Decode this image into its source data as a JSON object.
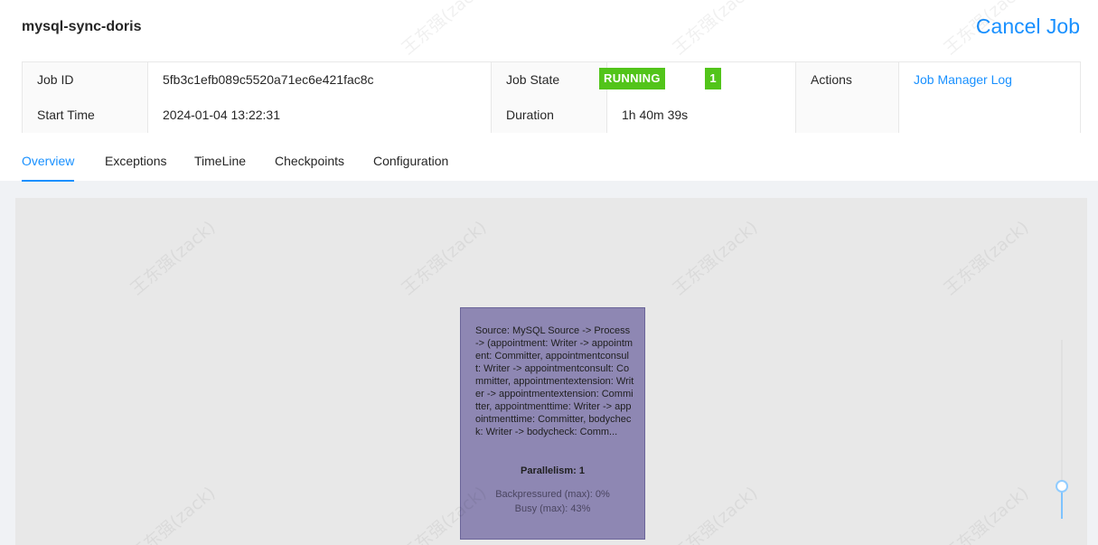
{
  "job": {
    "name": "mysql-sync-doris",
    "cancel_label": "Cancel Job"
  },
  "details": {
    "job_id_label": "Job ID",
    "job_id": "5fb3c1efb089c5520a71ec6e421fac8c",
    "job_state_label": "Job State",
    "job_state": "RUNNING",
    "running_count": "1",
    "actions_label": "Actions",
    "job_manager_log": "Job Manager Log",
    "start_time_label": "Start Time",
    "start_time": "2024-01-04 13:22:31",
    "duration_label": "Duration",
    "duration": "1h 40m 39s"
  },
  "tabs": [
    {
      "label": "Overview",
      "active": true
    },
    {
      "label": "Exceptions",
      "active": false
    },
    {
      "label": "TimeLine",
      "active": false
    },
    {
      "label": "Checkpoints",
      "active": false
    },
    {
      "label": "Configuration",
      "active": false
    }
  ],
  "graph": {
    "node": {
      "description": "Source: MySQL Source -> Process -> (appointment: Writer -> appointment: Committer, appointmentconsult: Writer -> appointmentconsult: Committer, appointmentextension: Writer -> appointmentextension: Committer, appointmenttime: Writer -> appointmenttime: Committer, bodycheck: Writer -> bodycheck: Comm...",
      "parallelism": "Parallelism: 1",
      "backpressured": "Backpressured (max): 0%",
      "busy": "Busy (max): 43%"
    },
    "zoom_level": 0.15
  },
  "watermark": "王东强(zack)",
  "colors": {
    "accent": "#1890ff",
    "running": "#52c41a",
    "node_fill": "#8e87b3"
  }
}
